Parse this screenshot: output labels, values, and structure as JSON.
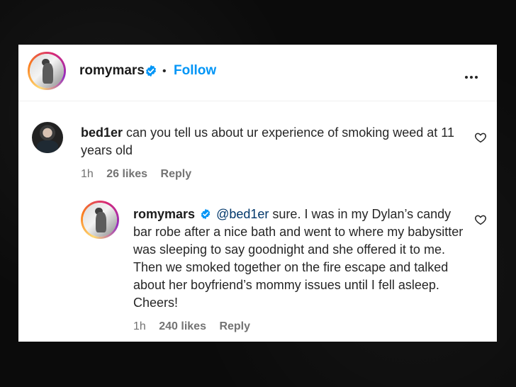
{
  "header": {
    "username": "romymars",
    "separator": "•",
    "follow_label": "Follow",
    "more_icon": "more-horizontal-icon"
  },
  "comments": [
    {
      "username": "bed1er",
      "text": "can you tell us about ur experience of smoking weed at 11 years old",
      "time": "1h",
      "likes": "26 likes",
      "reply_label": "Reply"
    }
  ],
  "reply": {
    "username": "romymars",
    "mention": "@bed1er",
    "text": "sure. I was in my Dylan’s candy bar robe after a nice bath and went to where my babysitter was sleeping to say goodnight and she offered it to me. Then we smoked together on the fire escape and talked about her boyfriend’s mommy issues until I fell asleep. Cheers!",
    "time": "1h",
    "likes": "240 likes",
    "reply_label": "Reply"
  },
  "colors": {
    "accent": "#0095f6",
    "verified": "#0095f6",
    "mention": "#00376b",
    "meta": "#737373"
  }
}
